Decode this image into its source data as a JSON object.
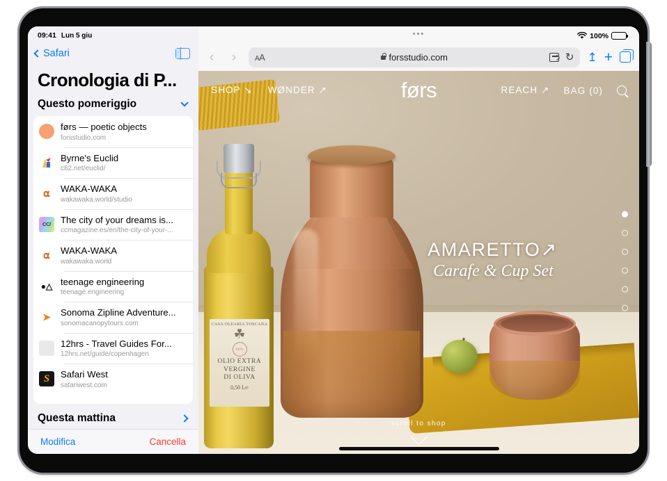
{
  "status_bar": {
    "time": "09:41",
    "date": "Lun 5 giu"
  },
  "browser_status": {
    "wifi": "wifi-icon",
    "battery_percent": "100%"
  },
  "sidebar": {
    "back_label": "Safari",
    "toggle_icon": "sidebar-toggle-icon",
    "title": "Cronologia di P...",
    "sections": [
      {
        "label": "Questo pomeriggio",
        "state": "expanded"
      },
      {
        "label": "Questa mattina",
        "state": "collapsed"
      }
    ],
    "items": [
      {
        "title": "førs — poetic objects",
        "url": "forsstudio.com",
        "favicon": "circle-favicon"
      },
      {
        "title": "Byrne's Euclid",
        "url": "c82.net/euclid/",
        "favicon": "euclid-favicon"
      },
      {
        "title": "WAKA-WAKA",
        "url": "wakawaka.world/studio",
        "favicon": "chair-favicon"
      },
      {
        "title": "The city of your dreams is...",
        "url": "ccmagazine.es/en/the-city-of-your-...",
        "favicon": "cc-favicon"
      },
      {
        "title": "WAKA-WAKA",
        "url": "wakawaka.world",
        "favicon": "chair-favicon"
      },
      {
        "title": "teenage engineering",
        "url": "teenage.engineering",
        "favicon": "ao-favicon"
      },
      {
        "title": "Sonoma Zipline Adventure...",
        "url": "sonomacanopytours.com",
        "favicon": "zipline-favicon"
      },
      {
        "title": "12hrs - Travel Guides For...",
        "url": "12hrs.net/guide/copenhagen",
        "favicon": "gray-favicon"
      },
      {
        "title": "Safari West",
        "url": "safariwest.com",
        "favicon": "s-favicon"
      }
    ],
    "footer": {
      "edit": "Modifica",
      "clear": "Cancella"
    }
  },
  "toolbar": {
    "back_icon": "chevron-left-icon",
    "forward_icon": "chevron-right-icon",
    "aa_label": "AA",
    "url": "forsstudio.com",
    "lock_icon": "lock-icon",
    "extension_icon": "extension-icon",
    "reload_icon": "reload-icon",
    "share_icon": "share-icon",
    "new_tab_icon": "plus-icon",
    "tabs_icon": "tabs-overview-icon"
  },
  "site": {
    "logo": "førs",
    "nav_left": [
      {
        "label": "SHOP ↘"
      },
      {
        "label": "WØNDER ↗"
      }
    ],
    "nav_right": [
      {
        "label": "REACH ↗"
      },
      {
        "label": "BAG (0)"
      }
    ],
    "search_icon": "search-icon",
    "hero": {
      "title": "AMARETTO↗",
      "subtitle": "Carafe & Cup Set"
    },
    "scroll_hint": "scroll to shop",
    "carousel": {
      "total": 6,
      "active_index": 0
    },
    "bottle_label": {
      "top": "CASA OLEARIA TOSCANA",
      "seal": "100%",
      "line1": "OLIO EXTRA",
      "line2": "VERGINE",
      "line3": "DI OLIVA",
      "volume": "0,50 L℮",
      "sprig": "☘"
    }
  },
  "colors": {
    "accent_blue": "#0a7aff",
    "destructive_red": "#ff3b30",
    "page_bg": "#c9bba6",
    "terracotta": "#cb8b61",
    "cloth_yellow": "#dcae22"
  }
}
